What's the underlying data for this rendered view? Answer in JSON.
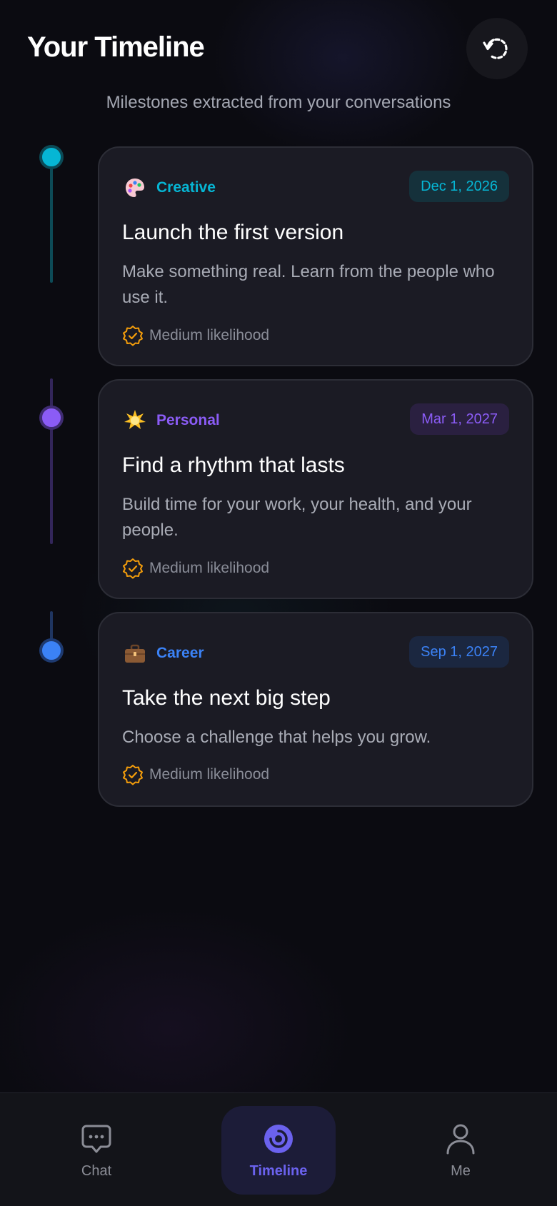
{
  "header": {
    "title": "Your Timeline",
    "subtitle": "Milestones extracted from your conversations",
    "refresh_icon": "refresh-icon"
  },
  "milestones": [
    {
      "category": "Creative",
      "category_icon": "palette-icon",
      "color": "#06b6d4",
      "badge_bg": "#15313b",
      "date": "Dec 1, 2026",
      "title": "Launch the first version",
      "description": "Make something real. Learn from the people who use it.",
      "likelihood": "Medium likelihood"
    },
    {
      "category": "Personal",
      "category_icon": "sparkle-icon",
      "color": "#8b5cf6",
      "badge_bg": "#2a2040",
      "date": "Mar 1, 2027",
      "title": "Find a rhythm that lasts",
      "description": "Build time for your work, your health, and your people.",
      "likelihood": "Medium likelihood"
    },
    {
      "category": "Career",
      "category_icon": "briefcase-icon",
      "color": "#3b82f6",
      "badge_bg": "#1b2740",
      "date": "Sep 1, 2027",
      "title": "Take the next big step",
      "description": "Choose a challenge that helps you grow.",
      "likelihood": "Medium likelihood"
    }
  ],
  "likelihood_color": "#f59e0b",
  "nav": {
    "items": [
      {
        "label": "Chat",
        "icon": "chat-icon",
        "active": false
      },
      {
        "label": "Timeline",
        "icon": "timeline-icon",
        "active": true
      },
      {
        "label": "Me",
        "icon": "person-icon",
        "active": false
      }
    ],
    "active_color": "#6b62ee"
  }
}
